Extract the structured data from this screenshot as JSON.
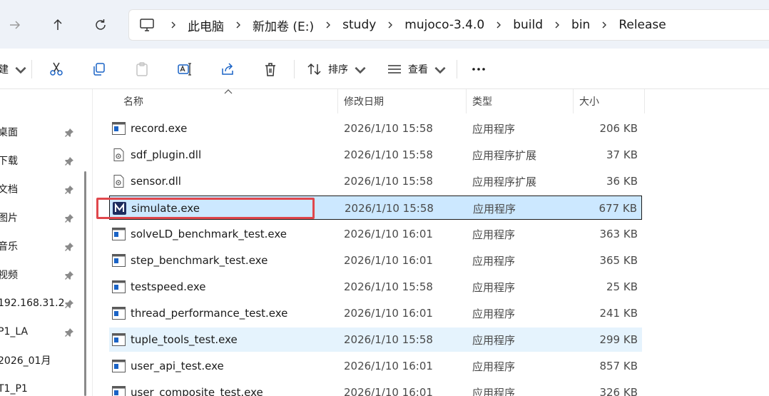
{
  "address_bar": {
    "crumbs": [
      "此电脑",
      "新加卷 (E:)",
      "study",
      "mujoco-3.4.0",
      "build",
      "bin",
      "Release"
    ]
  },
  "toolbar": {
    "new_label": "建",
    "sort_label": "排序",
    "view_label": "查看"
  },
  "nav": {
    "items": [
      {
        "label": "桌面",
        "pinned": true
      },
      {
        "label": "下载",
        "pinned": true
      },
      {
        "label": "文档",
        "pinned": true
      },
      {
        "label": "图片",
        "pinned": true
      },
      {
        "label": "音乐",
        "pinned": true
      },
      {
        "label": "视频",
        "pinned": true
      },
      {
        "label": "192.168.31.2",
        "pinned": true
      },
      {
        "label": "P1_LA",
        "pinned": true
      },
      {
        "label": "2026_01月",
        "pinned": false
      },
      {
        "label": "T1_P1",
        "pinned": false
      }
    ]
  },
  "columns": {
    "name": "名称",
    "date": "修改日期",
    "type": "类型",
    "size": "大小"
  },
  "files": [
    {
      "name": "record.exe",
      "date": "2026/1/10 15:58",
      "type": "应用程序",
      "size": "206 KB",
      "icon": "exe-icon",
      "state": ""
    },
    {
      "name": "sdf_plugin.dll",
      "date": "2026/1/10 15:58",
      "type": "应用程序扩展",
      "size": "37 KB",
      "icon": "dll-icon",
      "state": ""
    },
    {
      "name": "sensor.dll",
      "date": "2026/1/10 15:58",
      "type": "应用程序扩展",
      "size": "36 KB",
      "icon": "dll-icon",
      "state": ""
    },
    {
      "name": "simulate.exe",
      "date": "2026/1/10 15:58",
      "type": "应用程序",
      "size": "677 KB",
      "icon": "mujoco-icon",
      "state": "selected"
    },
    {
      "name": "solveLD_benchmark_test.exe",
      "date": "2026/1/10 16:01",
      "type": "应用程序",
      "size": "363 KB",
      "icon": "exe-icon",
      "state": ""
    },
    {
      "name": "step_benchmark_test.exe",
      "date": "2026/1/10 16:01",
      "type": "应用程序",
      "size": "365 KB",
      "icon": "exe-icon",
      "state": ""
    },
    {
      "name": "testspeed.exe",
      "date": "2026/1/10 15:58",
      "type": "应用程序",
      "size": "25 KB",
      "icon": "exe-icon",
      "state": ""
    },
    {
      "name": "thread_performance_test.exe",
      "date": "2026/1/10 16:01",
      "type": "应用程序",
      "size": "241 KB",
      "icon": "exe-icon",
      "state": ""
    },
    {
      "name": "tuple_tools_test.exe",
      "date": "2026/1/10 15:58",
      "type": "应用程序",
      "size": "299 KB",
      "icon": "exe-icon",
      "state": "hover"
    },
    {
      "name": "user_api_test.exe",
      "date": "2026/1/10 16:01",
      "type": "应用程序",
      "size": "857 KB",
      "icon": "exe-icon",
      "state": ""
    },
    {
      "name": "user_composite_test.exe",
      "date": "2026/1/10 16:01",
      "type": "应用程序",
      "size": "326 KB",
      "icon": "exe-icon",
      "state": ""
    }
  ],
  "colors": {
    "selection_bg": "#cce8ff",
    "hover_bg": "#e5f3fd",
    "annotation_red": "#e0474c",
    "accent_blue": "#1a63c6"
  }
}
